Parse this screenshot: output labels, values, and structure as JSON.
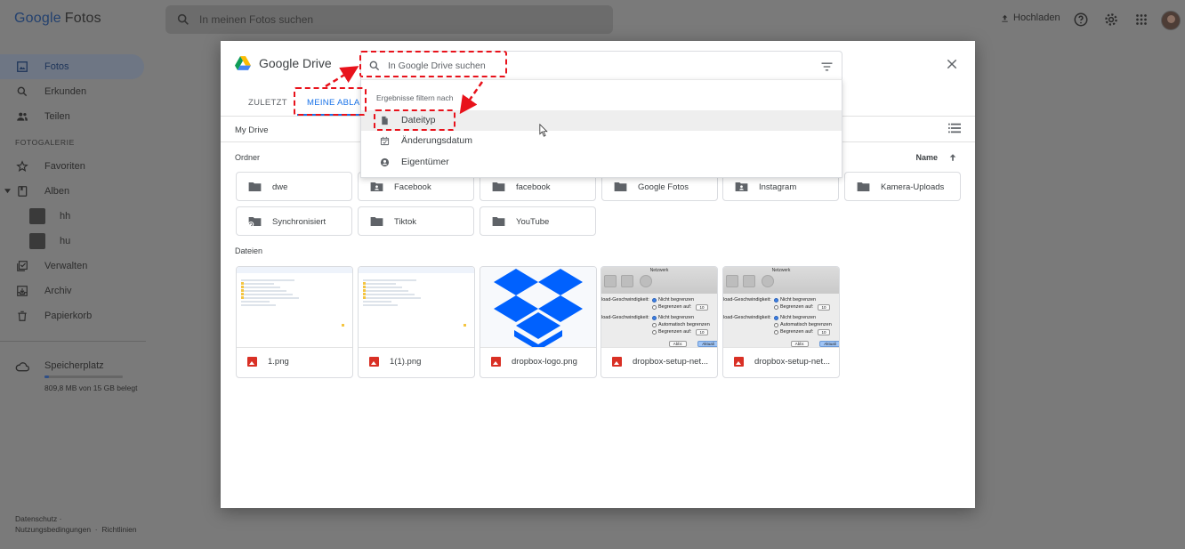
{
  "app": {
    "logo_google": "Google",
    "logo_product": "Fotos",
    "search_placeholder": "In meinen Fotos suchen",
    "upload_label": "Hochladen"
  },
  "sidebar": {
    "items": [
      {
        "label": "Fotos",
        "icon": "photo-icon",
        "active": true
      },
      {
        "label": "Erkunden",
        "icon": "search-icon"
      },
      {
        "label": "Teilen",
        "icon": "people-icon"
      }
    ],
    "section_label": "FOTOGALERIE",
    "gallery": [
      {
        "label": "Favoriten",
        "icon": "star-icon"
      },
      {
        "label": "Alben",
        "icon": "album-icon"
      }
    ],
    "albums": [
      {
        "label": "hh"
      },
      {
        "label": "hu"
      }
    ],
    "more": [
      {
        "label": "Verwalten",
        "icon": "checkbox-icon"
      },
      {
        "label": "Archiv",
        "icon": "archive-icon"
      },
      {
        "label": "Papierkorb",
        "icon": "trash-icon"
      }
    ],
    "storage": {
      "label": "Speicherplatz",
      "text": "809,8 MB von 15 GB belegt",
      "used_fraction": 0.053
    },
    "footer": {
      "privacy": "Datenschutz",
      "terms": "Nutzungsbedingungen",
      "guidelines": "Richtlinien"
    }
  },
  "dialog": {
    "title": "Google Drive",
    "tabs": [
      {
        "label": "ZULETZT"
      },
      {
        "label": "MEINE ABLAGE",
        "active": true
      }
    ],
    "breadcrumb": "My Drive",
    "folders_label": "Ordner",
    "sort_label": "Name",
    "folders": [
      {
        "name": "dwe",
        "icon": "folder-icon"
      },
      {
        "name": "Facebook",
        "icon": "shared-folder-icon"
      },
      {
        "name": "facebook",
        "icon": "folder-icon"
      },
      {
        "name": "Google Fotos",
        "icon": "folder-icon"
      },
      {
        "name": "Instagram",
        "icon": "shared-folder-icon"
      },
      {
        "name": "Kamera-Uploads",
        "icon": "folder-icon"
      },
      {
        "name": "Synchronisiert",
        "icon": "sync-folder-icon"
      },
      {
        "name": "Tiktok",
        "icon": "folder-icon"
      },
      {
        "name": "YouTube",
        "icon": "folder-icon"
      }
    ],
    "files_label": "Dateien",
    "files": [
      {
        "name": "1.png",
        "thumb": "screenshot"
      },
      {
        "name": "1(1).png",
        "thumb": "screenshot"
      },
      {
        "name": "dropbox-logo.png",
        "thumb": "dropbox"
      },
      {
        "name": "dropbox-setup-net...",
        "thumb": "mac"
      },
      {
        "name": "dropbox-setup-net...",
        "thumb": "mac"
      }
    ],
    "mac_thumb": {
      "title": "Netzwerk",
      "row1_label": "load-Geschwindigkeit:",
      "row2_label": "load-Geschwindigkeit:",
      "opt_none": "Nicht begrenzen",
      "opt_limit": "Begrenzen auf:",
      "opt_auto": "Automatisch begrenzen",
      "val": "10",
      "btn_cancel": "Abbr.",
      "btn_ok": "Aktuali"
    }
  },
  "drive_search": {
    "placeholder": "In Google Drive suchen",
    "filter_title": "Ergebnisse filtern nach",
    "options": [
      {
        "label": "Dateityp",
        "icon": "file-icon",
        "hover": true
      },
      {
        "label": "Änderungsdatum",
        "icon": "calendar-icon"
      },
      {
        "label": "Eigentümer",
        "icon": "account-icon"
      }
    ]
  },
  "colors": {
    "accent": "#1a73e8",
    "annotation": "#e8121b",
    "file_icon_red": "#d93025",
    "dropbox_blue": "#0061fe"
  }
}
